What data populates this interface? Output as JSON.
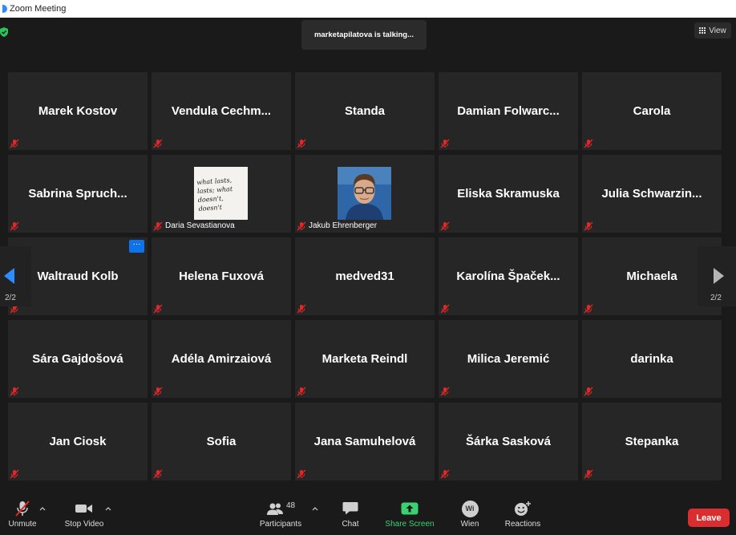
{
  "window": {
    "title": "Zoom Meeting"
  },
  "header": {
    "talking_indicator": "marketapilatova is talking...",
    "view_label": "View"
  },
  "participants": [
    "Marek  Kostov",
    "Vendula  Cechm...",
    "Standa",
    "Damian  Folwarc...",
    "Carola",
    "Sabrina  Spruch...",
    "",
    "",
    "Eliska  Skramuska",
    "Julia  Schwarzin...",
    "Waltraud  Kolb",
    "Helena  Fuxová",
    "medved31",
    "Karolína  Špaček...",
    "Michaela",
    "Sára  Gajdošová",
    "Adéla  Amirzaiová",
    "Marketa  Reindl",
    "Milica  Jeremić",
    "darinka",
    "Jan  Ciosk",
    "Sofia",
    "Jana  Samuhelová",
    "Šárka  Sasková",
    "Stepanka"
  ],
  "video_tiles": {
    "daria": {
      "name": "Daria Sevastianova",
      "avatar_text": "what lasts, lasts; what doesn't, doesn't"
    },
    "jakub": {
      "name": "Jakub Ehrenberger"
    }
  },
  "pagination": {
    "left_page": "2/2",
    "right_page": "2/2"
  },
  "tile_more_button": "···",
  "toolbar": {
    "unmute": "Unmute",
    "stop_video": "Stop Video",
    "participants": "Participants",
    "participants_count": "48",
    "chat": "Chat",
    "share_screen": "Share Screen",
    "wien": "Wien",
    "wien_avatar": "Wi",
    "reactions": "Reactions",
    "leave": "Leave"
  },
  "colors": {
    "background": "#1a1a1a",
    "tile": "#262626",
    "mute_red": "#e02828",
    "share_green": "#3bd171",
    "leave_red": "#d92d2f",
    "accent_blue": "#0e72ed"
  }
}
